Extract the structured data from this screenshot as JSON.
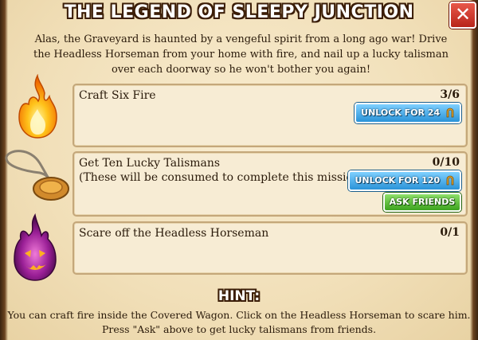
{
  "dialog": {
    "title": "THE LEGEND OF SLEEPY JUNCTION",
    "close_label": "✕",
    "intro": "Alas, the Graveyard is haunted by a vengeful spirit from a long ago war! Drive the Headless Horseman from your home with fire, and nail up a lucky talisman over each doorway so he won't bother you again!"
  },
  "tasks": [
    {
      "label": "Craft Six Fire",
      "count": "3/6",
      "unlock_label": "UNLOCK FOR 24",
      "icon": "fire-icon"
    },
    {
      "label": "Get Ten Lucky Talismans",
      "sublabel": "(These will be consumed to complete this mission)",
      "count": "0/10",
      "unlock_label": "UNLOCK FOR 120",
      "ask_label": "ASK FRIENDS",
      "icon": "talisman-icon"
    },
    {
      "label": "Scare off the Headless Horseman",
      "count": "0/1",
      "icon": "pumpkin-ghost-icon"
    }
  ],
  "hint": {
    "title": "HINT:",
    "text": "You can craft fire inside the Covered Wagon. Click on the Headless Horseman to scare him. Press \"Ask\" above to get lucky talismans from friends."
  },
  "colors": {
    "unlock_button": "#2a93d8",
    "ask_button": "#3da31f",
    "close_button": "#d6392c",
    "panel_border": "#c4a77a"
  }
}
